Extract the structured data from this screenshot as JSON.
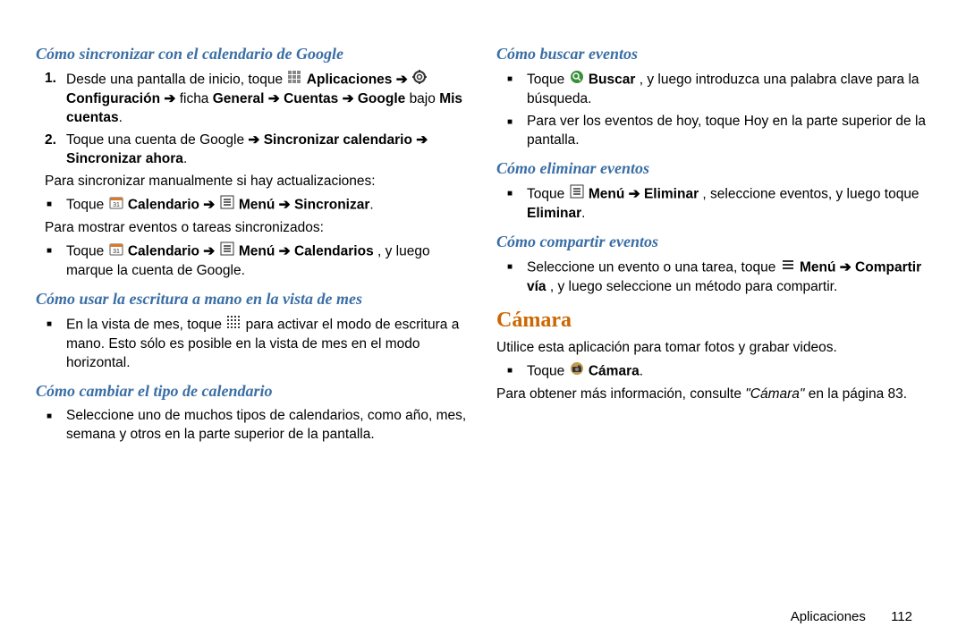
{
  "left": {
    "h3_1": "Cómo sincronizar con el calendario de Google",
    "ol1_t1": "Desde una pantalla de inicio, toque ",
    "ol1_app": "Aplicaciones",
    "ol1_arrow": " ➔ ",
    "ol1_conf": "Configuración",
    "ol1_tab": " ficha ",
    "ol1_gen": "General",
    "ol1_acc": "Cuentas",
    "ol1_goog": "Google",
    "ol1_bajo": " bajo ",
    "ol1_mis": "Mis cuentas",
    "ol2_t1": "Toque una cuenta de Google ",
    "ol2_sync": "Sincronizar calendario",
    "ol2_now": "Sincronizar ahora",
    "p1": "Para sincronizar manualmente si hay actualizaciones:",
    "ul1_t": "Toque ",
    "ul1_cal": "Calendario",
    "ul1_menu": "Menú",
    "ul1_sync": "Sincronizar",
    "p2": "Para mostrar eventos o tareas sincronizados:",
    "ul2_t": "Toque ",
    "ul2_cal": "Calendario",
    "ul2_menu": "Menú",
    "ul2_cals": "Calendarios",
    "ul2_rest": ", y luego marque la cuenta de Google.",
    "h3_2": "Cómo usar la escritura a mano en la vista de mes",
    "ul3_a": "En la vista de mes, toque ",
    "ul3_b": " para activar el modo de escritura a mano. Esto sólo es posible en la vista de mes en el modo horizontal.",
    "h3_3": "Cómo cambiar el tipo de calendario",
    "ul4": "Seleccione uno de muchos tipos de calendarios, como año, mes, semana y otros en la parte superior de la pantalla."
  },
  "right": {
    "h3_1": "Cómo buscar eventos",
    "ul1_a": "Toque ",
    "ul1_b": "Buscar",
    "ul1_c": ", y luego introduzca una palabra clave para la búsqueda.",
    "ul2": "Para ver los eventos de hoy, toque Hoy en la parte superior de la pantalla.",
    "h3_2": "Cómo eliminar eventos",
    "ul3_a": "Toque ",
    "ul3_menu": "Menú",
    "ul3_del": "Eliminar",
    "ul3_b": ", seleccione eventos, y luego toque ",
    "ul3_del2": "Eliminar",
    "h3_3": "Cómo compartir eventos",
    "ul4_a": "Seleccione un evento o una tarea, toque ",
    "ul4_menu": "Menú",
    "ul4_share": "Compartir vía",
    "ul4_b": ", y luego seleccione un método para compartir.",
    "h2": "Cámara",
    "p1": "Utilice esta aplicación para tomar fotos y grabar videos.",
    "ul5_a": "Toque ",
    "ul5_cam": "Cámara",
    "p2_a": "Para obtener más información, consulte ",
    "p2_ref": "\"Cámara\"",
    "p2_b": " en la página 83."
  },
  "footer": {
    "section": "Aplicaciones",
    "page": "112"
  },
  "arrow": "➔",
  "dot": "."
}
